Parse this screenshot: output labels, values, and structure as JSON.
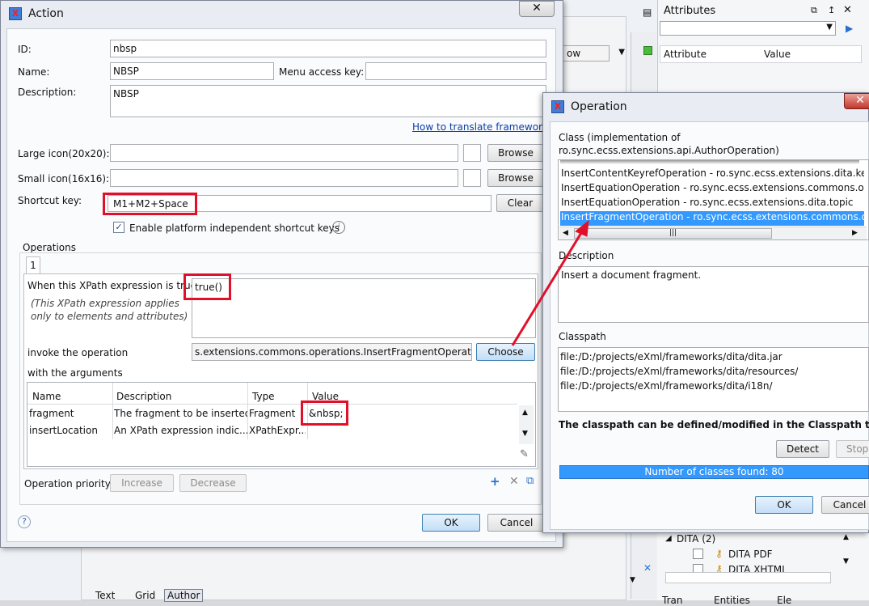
{
  "colors": {
    "accent": "#3399ff",
    "highlight": "#e0102a",
    "link": "#0b3ea8"
  },
  "background": {
    "view_combo": "ow",
    "attributes_title": "Attributes",
    "attr_table": {
      "col1": "Attribute",
      "col2": "Value"
    },
    "tree": {
      "group": "DITA (2)",
      "item1": "DITA PDF",
      "item2": "DITA XHTML",
      "tabs": [
        "Tran",
        "Entities",
        "Ele"
      ]
    },
    "bottom_tabs": [
      "Text",
      "Grid",
      "Author"
    ]
  },
  "action": {
    "title": "Action",
    "id_label": "ID:",
    "id_value": "nbsp",
    "name_label": "Name:",
    "name_value": "NBSP",
    "menu_key_label": "Menu access key:",
    "menu_key_value": "",
    "description_label": "Description:",
    "description_value": "NBSP",
    "translate_link": "How to translate framework",
    "large_icon_label": "Large icon(20x20):",
    "small_icon_label": "Small icon(16x16):",
    "browse": "Browse",
    "shortcut_label": "Shortcut key:",
    "shortcut_value": "M1+M2+Space",
    "clear": "Clear",
    "platform_checkbox": "Enable platform independent shortcut keys",
    "operations_label": "Operations",
    "tab": "1",
    "xpath_label": "When this XPath expression is true",
    "xpath_value": "true()",
    "xpath_note_1": "(This XPath expression applies",
    "xpath_note_2": "only to elements and attributes)",
    "invoke_label": "invoke the operation",
    "invoke_value": "s.extensions.commons.operations.InsertFragmentOperation",
    "choose": "Choose",
    "args_label": "with the arguments",
    "args_columns": [
      "Name",
      "Description",
      "Type",
      "Value"
    ],
    "args_rows": [
      {
        "name": "fragment",
        "desc": "The fragment to be inserted",
        "type": "Fragment",
        "value": "&nbsp;"
      },
      {
        "name": "insertLocation",
        "desc": "An XPath expression indic...",
        "type": "XPathExpr...",
        "value": ""
      }
    ],
    "priority_label": "Operation priority",
    "increase": "Increase",
    "decrease": "Decrease",
    "ok": "OK",
    "cancel": "Cancel"
  },
  "operation": {
    "title": "Operation",
    "class_label_1": "Class (implementation of",
    "class_label_2": "ro.sync.ecss.extensions.api.AuthorOperation)",
    "class_items": [
      "InsertContentKeyrefOperation - ro.sync.ecss.extensions.dita.keyre",
      "InsertEquationOperation - ro.sync.ecss.extensions.commons.opera",
      "InsertEquationOperation - ro.sync.ecss.extensions.dita.topic",
      "InsertFragmentOperation - ro.sync.ecss.extensions.commons.ope"
    ],
    "description_label": "Description",
    "description_value": "Insert a document fragment.",
    "classpath_label": "Classpath",
    "classpath_items": [
      "file:/D:/projects/eXml/frameworks/dita/dita.jar",
      "file:/D:/projects/eXml/frameworks/dita/resources/",
      "file:/D:/projects/eXml/frameworks/dita/i18n/"
    ],
    "classpath_note": "The classpath can be defined/modified in the Classpath tab",
    "detect": "Detect",
    "stop": "Stop",
    "progress_text": "Number of classes found: 80",
    "ok": "OK",
    "cancel": "Cancel"
  }
}
